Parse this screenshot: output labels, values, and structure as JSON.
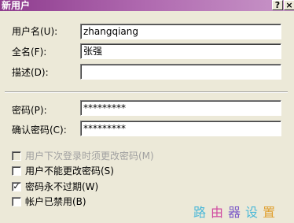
{
  "window": {
    "title": "新用户",
    "help_label": "?",
    "close_label": "×"
  },
  "form": {
    "username_label": "用户名(U):",
    "username_value": "zhangqiang",
    "fullname_label": "全名(F):",
    "fullname_value": "张强",
    "description_label": "描述(D):",
    "description_value": "",
    "password_label": "密码(P):",
    "password_value": "*********",
    "confirm_label": "确认密码(C):",
    "confirm_value": "*********"
  },
  "options": [
    {
      "label": "用户下次登录时须更改密码(M)",
      "checked": false,
      "enabled": false
    },
    {
      "label": "用户不能更改密码(S)",
      "checked": false,
      "enabled": true
    },
    {
      "label": "密码永不过期(W)",
      "checked": true,
      "enabled": true
    },
    {
      "label": "帐户已禁用(B)",
      "checked": false,
      "enabled": true
    }
  ],
  "watermark": {
    "c1": "路",
    "c2": "由",
    "c3": "器",
    "c4": "设",
    "c5": "置"
  }
}
